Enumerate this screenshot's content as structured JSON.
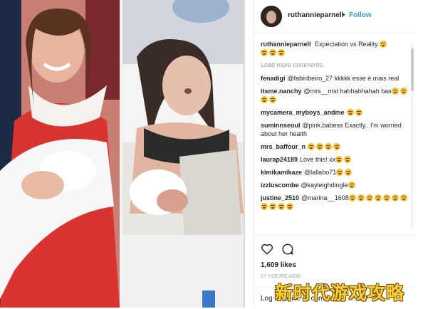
{
  "post": {
    "username": "ruthannieparnell",
    "dot": "•",
    "follow_label": "Follow",
    "caption_user": "ruthannieparnell",
    "caption_text": "Expectation vs Reality",
    "load_more": "Load more comments",
    "likes": "1,609 likes",
    "time": "17 HOURS AGO",
    "add_comment_hint": "Log in to like or comment."
  },
  "comments": [
    {
      "user": "fenadigi",
      "text": "@fabiribeiro_27 kkkkk esse é mais real",
      "emoji_count": 0
    },
    {
      "user": "itsme.nanchy",
      "text": "@mrs__mst hahhahhahah bas",
      "emoji_count": 4
    },
    {
      "user": "mycamera_myboys_andme",
      "text": "",
      "emoji_count": 2
    },
    {
      "user": "suminnseoul",
      "text": "@pink.babess Exactly.. I'm worried about her health",
      "emoji_count": 0
    },
    {
      "user": "mrs_baffour_n",
      "text": "",
      "emoji_count": 4
    },
    {
      "user": "laurap24189",
      "text": "Love this! xx",
      "emoji_count": 2
    },
    {
      "user": "kimikamikaze",
      "text": "@lallabo71",
      "emoji_count": 2
    },
    {
      "user": "izzluscombe",
      "text": "@kayleighdingle",
      "emoji_count": 1
    },
    {
      "user": "justine_2510",
      "text": "@marina__1608",
      "emoji_count": 11
    }
  ],
  "watermark": "新时代游戏攻略",
  "colors": {
    "link": "#3897f0",
    "text": "#262626",
    "muted": "#999999"
  },
  "icons": [
    "heart-icon",
    "comment-icon"
  ]
}
